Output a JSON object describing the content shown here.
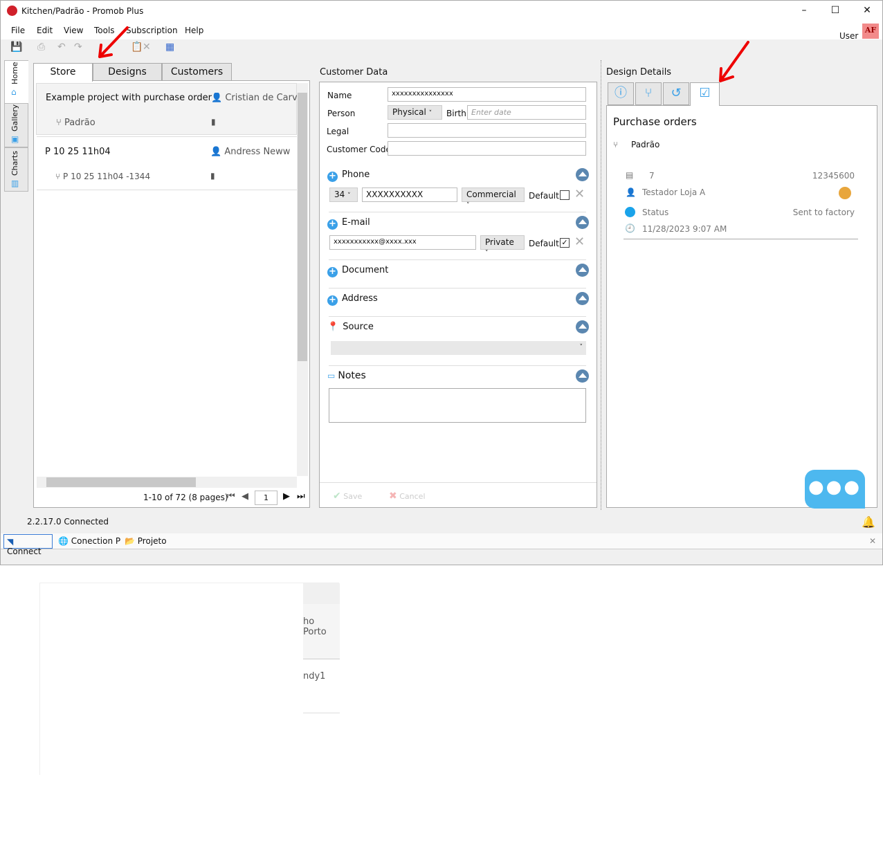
{
  "window": {
    "title": "Kitchen/Padrão - Promob Plus"
  },
  "menu": [
    "File",
    "Edit",
    "View",
    "Tools",
    "Subscription",
    "Help"
  ],
  "user": {
    "label": "User",
    "badge": "AF"
  },
  "side_tabs": [
    "Home",
    "Gallery",
    "Charts"
  ],
  "left": {
    "tabs": [
      "Store",
      "Designs",
      "Customers"
    ],
    "projects": [
      {
        "name": "Example project with purchase order",
        "owner": "Cristian de Carv",
        "design": "Padrão"
      },
      {
        "name": "P 10 25 11h04",
        "owner": "Andress Neww",
        "design": "P 10 25 11h04 -1344"
      }
    ],
    "pagination": {
      "summary": "1-10 of 72 (8 pages)",
      "page": "1"
    }
  },
  "customer": {
    "title": "Customer Data",
    "name_label": "Name",
    "name_value": "xxxxxxxxxxxxxxx",
    "person_label": "Person",
    "person_value": "Physical",
    "birth_label": "Birth",
    "birth_placeholder": "Enter date",
    "legal_label": "Legal",
    "code_label": "Customer Code",
    "phone": {
      "label": "Phone",
      "code": "34",
      "number": "XXXXXXXXXX",
      "type": "Commercial",
      "default_label": "Default",
      "default_checked": false
    },
    "email": {
      "label": "E-mail",
      "address": "xxxxxxxxxxx@xxxx.xxx",
      "type": "Private",
      "default_label": "Default",
      "default_checked": true
    },
    "document_label": "Document",
    "address_label": "Address",
    "source_label": "Source",
    "notes_label": "Notes",
    "save": "Save",
    "cancel": "Cancel"
  },
  "details": {
    "title": "Design Details",
    "heading": "Purchase orders",
    "design": "Padrão",
    "order_number": "7",
    "order_code": "12345600",
    "store": "Testador Loja A",
    "status_label": "Status",
    "status_value": "Sent to factory",
    "date": "11/28/2023 9:07 AM",
    "status_color": "#1aa3ea"
  },
  "status": {
    "text": "2.2.17.0  Connected"
  },
  "bottom_tabs": [
    "Connect",
    "Conection P",
    "Projeto"
  ],
  "ghost": {
    "line1": "ho Porto",
    "line2": "ndy1"
  }
}
